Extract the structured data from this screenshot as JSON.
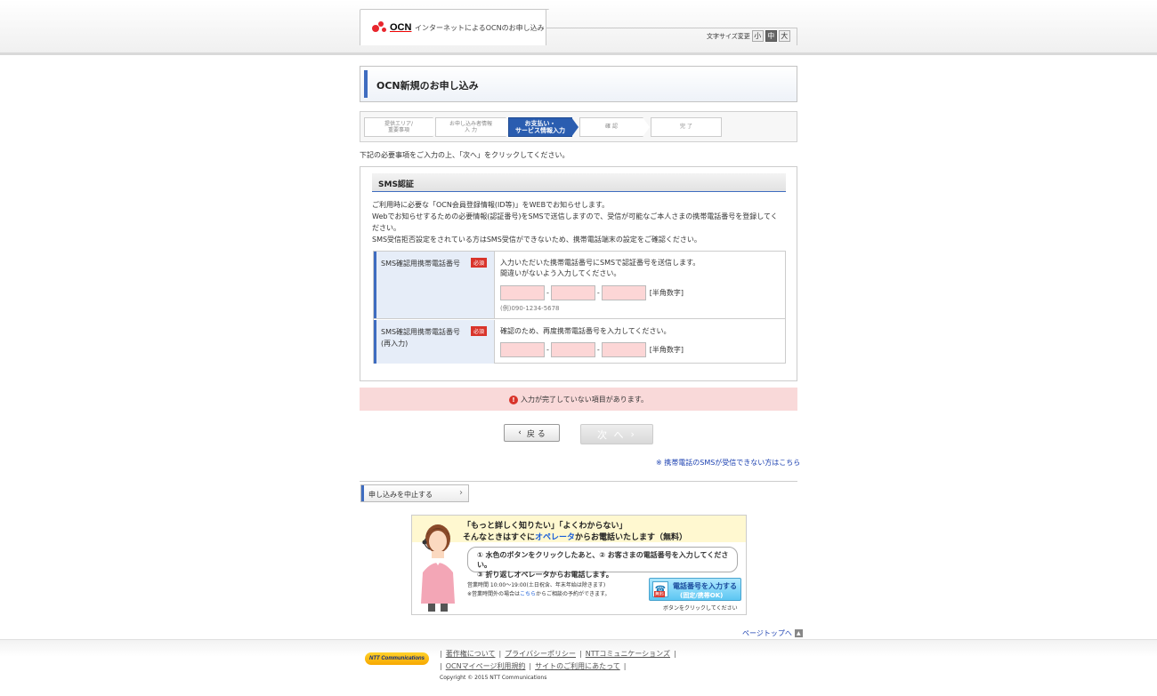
{
  "header": {
    "logo_text": "OCN",
    "subtitle": "インターネットによるOCNのお申し込み",
    "font_size_label": "文字サイズ変更",
    "font_sizes": [
      "小",
      "中",
      "大"
    ]
  },
  "page_title": "OCN新規のお申し込み",
  "steps": [
    {
      "line1": "提供エリア/",
      "line2": "重要事項"
    },
    {
      "line1": "お申し込み者情報",
      "line2": "入 力"
    },
    {
      "line1": "お支払い・",
      "line2": "サービス情報入力"
    },
    {
      "line1": "確 認",
      "line2": ""
    },
    {
      "line1": "完 了",
      "line2": ""
    }
  ],
  "instruction": "下記の必要事項をご入力の上、「次へ」をクリックしてください。",
  "sms": {
    "heading": "SMS認証",
    "desc1": "ご利用時に必要な「OCN会員登録情報(ID等)」をWEBでお知らせします。",
    "desc2": "Webでお知らせするための必要情報(認証番号)をSMSで送信しますので、受信が可能なご本人さまの携帯電話番号を登録してください。",
    "desc3": "SMS受信拒否設定をされている方はSMS受信ができないため、携帯電話端末の設定をご確認ください。",
    "row1": {
      "label": "SMS確認用携帯電話番号",
      "required": "必須",
      "text1": "入力いただいた携帯電話番号にSMSで認証番号を送信します。",
      "text2": "間違いがないよう入力してください。",
      "hint": "[半角数字]",
      "example": "(例)090-1234-5678"
    },
    "row2": {
      "label1": "SMS確認用携帯電話番号",
      "label2": "(再入力)",
      "required": "必須",
      "text1": "確認のため、再度携帯電話番号を入力してください。",
      "hint": "[半角数字]"
    }
  },
  "error_message": "入力が完了していない項目があります。",
  "buttons": {
    "back": "戻 る",
    "next": "次 へ"
  },
  "sms_link": "※ 携帯電話のSMSが受信できない方はこちら",
  "cancel": "申し込みを中止する",
  "banner": {
    "h1": "「もっと詳しく知りたい」「よくわからない」",
    "h2_a": "そんなときはすぐに",
    "h2_op": "オペレータ",
    "h2_b": "からお電話いたします（無料）",
    "step1": "① 水色のボタンをクリックしたあと、② お客さまの電話番号を入力してください。",
    "step2": "③ 折り返しオペレータからお電話します。",
    "hours": "営業時間 10:00〜19:00(土日祝含、年末年始は除きます)",
    "note_a": "※営業時間外の場合は",
    "note_link": "こちら",
    "note_b": "からご相談の予約ができます。",
    "call_t1": "電話番号を入力する",
    "call_t2": "(固定/携帯OK)",
    "free": "無料",
    "call_note": "ボタンをクリックしてください"
  },
  "pagetop": "ページトップへ",
  "footer": {
    "logo": "NTT Communications",
    "links_row1": [
      "著作権について",
      "プライバシーポリシー",
      "NTTコミュニケーションズ"
    ],
    "links_row2": [
      "OCNマイページ利用規約",
      "サイトのご利用にあたって"
    ],
    "copyright": "Copyright © 2015 NTT Communications"
  },
  "colors": {
    "accent": "#3e6cc0",
    "step_active": "#2a5db0",
    "error_bg": "#f9d9d9",
    "input_error_bg": "#fcd6d6",
    "required": "#d9342b"
  }
}
